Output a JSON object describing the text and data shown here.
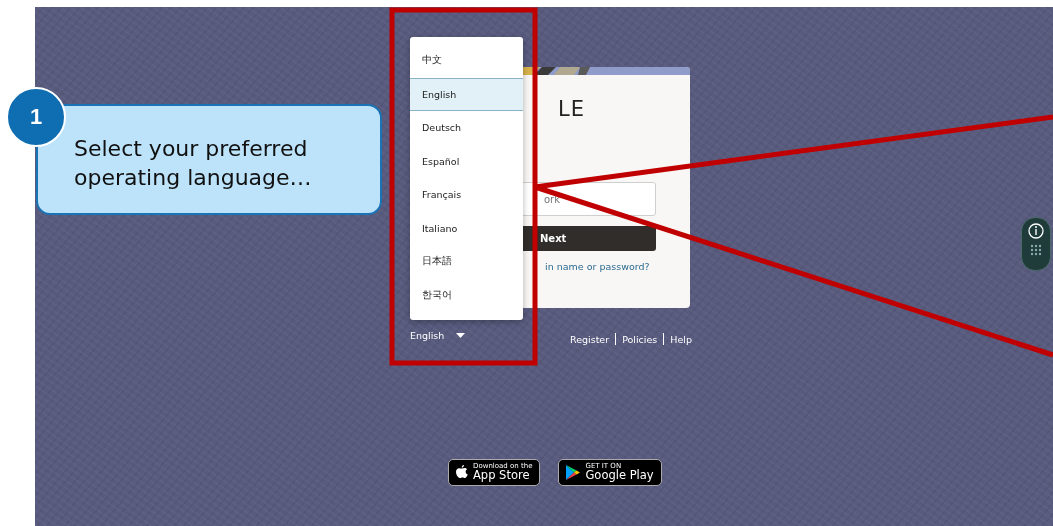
{
  "callout": {
    "step": "1",
    "text": "Select your preferred operating language…"
  },
  "login": {
    "logo": "LE",
    "field": {
      "placeholder": "ork"
    },
    "next_button": "Next",
    "forgot_link": "in name or password?"
  },
  "language_menu": {
    "items": [
      {
        "label": "中文",
        "selected": false
      },
      {
        "label": "English",
        "selected": true
      },
      {
        "label": "Deutsch",
        "selected": false
      },
      {
        "label": "Español",
        "selected": false
      },
      {
        "label": "Français",
        "selected": false
      },
      {
        "label": "Italiano",
        "selected": false
      },
      {
        "label": "日本語",
        "selected": false
      },
      {
        "label": "한국어",
        "selected": false
      }
    ]
  },
  "language_select": {
    "value": "English"
  },
  "footer_links": [
    "Register",
    "Policies",
    "Help"
  ],
  "store_badges": [
    {
      "kind": "apple",
      "small": "Download on the",
      "large": "App Store"
    },
    {
      "kind": "google",
      "small": "GET IT ON",
      "large": "Google Play"
    }
  ]
}
